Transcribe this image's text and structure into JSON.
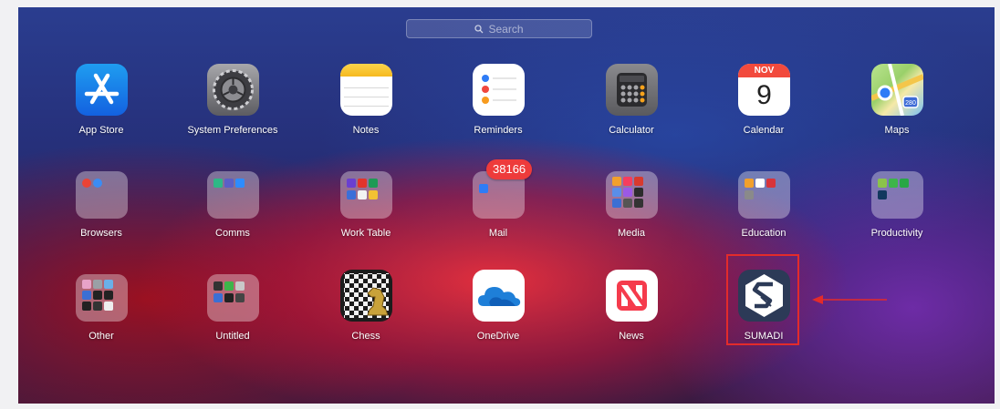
{
  "search": {
    "placeholder": "Search",
    "icon": "magnifier-icon"
  },
  "apps": {
    "app_store": "App Store",
    "system_preferences": "System Preferences",
    "notes": "Notes",
    "reminders": "Reminders",
    "calculator": "Calculator",
    "calendar": "Calendar",
    "calendar_month": "NOV",
    "calendar_day": "9",
    "maps": "Maps",
    "browsers": "Browsers",
    "comms": "Comms",
    "work_table": "Work Table",
    "mail": "Mail",
    "mail_badge": "38166",
    "media": "Media",
    "education": "Education",
    "productivity": "Productivity",
    "other": "Other",
    "untitled": "Untitled",
    "chess": "Chess",
    "onedrive": "OneDrive",
    "news": "News",
    "sumadi": "SUMADI",
    "maps_shield": "280"
  },
  "colors": {
    "highlight": "#e32b2b",
    "badge": "#ee3b3b"
  }
}
